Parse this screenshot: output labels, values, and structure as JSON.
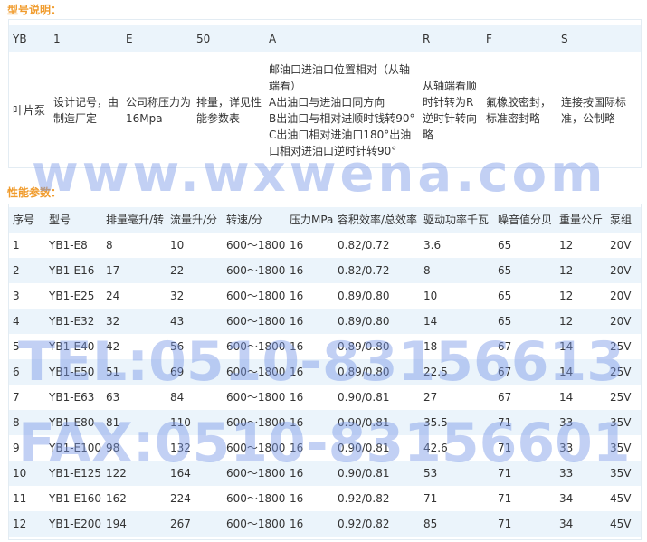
{
  "titles": {
    "model": "型号说明：",
    "performance": "性能参数："
  },
  "model_table": {
    "codes": [
      "YB",
      "1",
      "E",
      "50",
      "A",
      "R",
      "F",
      "S"
    ],
    "meanings": [
      "叶片泵",
      "设计记号，由制造厂定",
      "公司称压力为16Mpa",
      "排量，详见性能参数表",
      "邮油口进油口位置相对（从轴端看）\nA出油口与进油口同方向\nB出油口与相对进顺时钱转90°\nC出油口相对进油口180°出油口相对进油口逆时针转90°",
      "从轴端看顺时针转为R逆时针转向略",
      "氟橡胶密封，标准密封略",
      "连接按国际标准，公制略"
    ]
  },
  "performance_table": {
    "headers": [
      "序号",
      "型号",
      "排量毫升/转",
      "流量升/分",
      "转速/分",
      "压力MPa",
      "容积效率/总效率",
      "驱动功率千瓦",
      "噪音值分贝",
      "重量公斤",
      "泵组"
    ],
    "rows": [
      [
        "1",
        "YB1-E8",
        "8",
        "10",
        "600～1800",
        "16",
        "0.82/0.72",
        "3.6",
        "65",
        "12",
        "20V"
      ],
      [
        "2",
        "YB1-E16",
        "17",
        "22",
        "600～1800",
        "16",
        "0.82/0.72",
        "8",
        "65",
        "12",
        "20V"
      ],
      [
        "3",
        "YB1-E25",
        "24",
        "32",
        "600～1800",
        "16",
        "0.89/0.80",
        "10",
        "65",
        "12",
        "20V"
      ],
      [
        "4",
        "YB1-E32",
        "32",
        "43",
        "600～1800",
        "16",
        "0.89/0.80",
        "14",
        "65",
        "12",
        "20V"
      ],
      [
        "5",
        "YB1-E40",
        "42",
        "56",
        "600～1800",
        "16",
        "0.89/0.80",
        "18",
        "67",
        "14",
        "25V"
      ],
      [
        "6",
        "YB1-E50",
        "51",
        "69",
        "600～1800",
        "16",
        "0.89/0.80",
        "22.5",
        "67",
        "14",
        "25V"
      ],
      [
        "7",
        "YB1-E63",
        "63",
        "84",
        "600～1800",
        "16",
        "0.90/0.81",
        "27",
        "67",
        "14",
        "25V"
      ],
      [
        "8",
        "YB1-E80",
        "81",
        "110",
        "600～1800",
        "16",
        "0.90/0.81",
        "35.5",
        "71",
        "33",
        "35V"
      ],
      [
        "9",
        "YB1-E100",
        "98",
        "132",
        "600～1800",
        "16",
        "0.90/0.81",
        "42.6",
        "71",
        "33",
        "35V"
      ],
      [
        "10",
        "YB1-E125",
        "122",
        "164",
        "600～1800",
        "16",
        "0.90/0.81",
        "53",
        "71",
        "33",
        "35V"
      ],
      [
        "11",
        "YB1-E160",
        "162",
        "224",
        "600～1800",
        "16",
        "0.92/0.82",
        "71",
        "71",
        "34",
        "45V"
      ],
      [
        "12",
        "YB1-E200",
        "194",
        "267",
        "600～1800",
        "16",
        "0.92/0.82",
        "85",
        "71",
        "34",
        "45V"
      ]
    ]
  },
  "watermarks": {
    "site": "www.wxwena.com",
    "tel": "TEL:0510-83156613",
    "fax": "FAX:0510-83156601"
  }
}
